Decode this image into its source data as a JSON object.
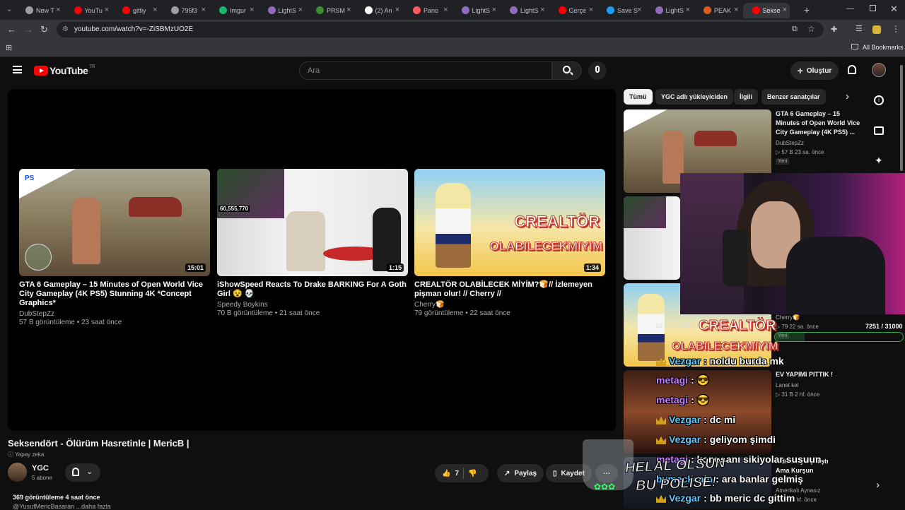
{
  "browser": {
    "tabs": [
      {
        "label": "New T",
        "color": "#9aa0a6"
      },
      {
        "label": "YouTu",
        "color": "#ff0000"
      },
      {
        "label": "gittiy",
        "color": "#ff0000"
      },
      {
        "label": "795f3",
        "color": "#9aa0a6"
      },
      {
        "label": "Imgur",
        "color": "#1bb76e"
      },
      {
        "label": "LightS",
        "color": "#8e6bbf"
      },
      {
        "label": "PRSM",
        "color": "#3c8d2f"
      },
      {
        "label": "(2) An",
        "color": "#ffffff"
      },
      {
        "label": "Pano",
        "color": "#ff5a5f"
      },
      {
        "label": "LightS",
        "color": "#8e6bbf"
      },
      {
        "label": "LightS",
        "color": "#8e6bbf"
      },
      {
        "label": "Gerçe",
        "color": "#ff0000"
      },
      {
        "label": "Save S",
        "color": "#1d9bf0"
      },
      {
        "label": "LightS",
        "color": "#8e6bbf"
      },
      {
        "label": "PEAK",
        "color": "#e05a1c"
      },
      {
        "label": "Sekse",
        "color": "#ff0000",
        "active": true
      }
    ],
    "url": "youtube.com/watch?v=-ZiSBMzUO2E",
    "bookmarks_label": "All Bookmarks"
  },
  "youtube": {
    "logo": "YouTube",
    "region": "TR",
    "search_placeholder": "Ara",
    "create_label": "Oluştur"
  },
  "player": {
    "endcards": [
      {
        "title": "GTA 6 Gameplay – 15 Minutes of Open World Vice City Gameplay (4K PS5) Stunning 4K *Concept Graphics*",
        "channel": "DubStepZz",
        "meta": "57 B görüntüleme • 23 saat önce",
        "duration": "15:01"
      },
      {
        "title": "iShowSpeed Reacts To Drake BARKING For A Goth Girl 😵 💀",
        "channel": "Speedy Boykins",
        "meta": "70 B görüntüleme • 21 saat önce",
        "duration": "1:15",
        "overlay_count": "60,555,770"
      },
      {
        "title": "CREALTÖR OLABİLECEK MİYİM?🍞// İzlemeyen pişman olur! // Cherry //",
        "channel": "Cherry🍞",
        "meta": "79 görüntüleme • 22 saat önce",
        "duration": "1:34",
        "thumb_text_1": "CREALTÖR",
        "thumb_text_2": "OLABILECEKMIYIM"
      }
    ]
  },
  "video": {
    "title": "Seksendört - Ölürüm Hasretinle | MericB |",
    "ai_badge": "Yapay zeka",
    "channel_name": "YGC",
    "subscribers": "5 abone",
    "likes": "7",
    "share_label": "Paylaş",
    "save_label": "Kaydet",
    "stats": "369 görüntüleme  4 saat önce",
    "description_preview": "@YusufMericBasaran ...daha fazla"
  },
  "sidebar": {
    "chips": [
      "Tümü",
      "YGC adlı yükleyiciden",
      "İlgili",
      "Benzer sanatçılar"
    ],
    "items": [
      {
        "title": "GTA 6 Gameplay – 15 Minutes of Open World Vice City Gameplay (4K PS5) ...",
        "channel": "DubStepZz",
        "meta": "▷ 57 B  23 sa. önce",
        "badge": "Yeni"
      },
      {
        "title": "",
        "channel": "",
        "meta": "",
        "badge": ""
      },
      {
        "title": "",
        "channel": "Cherry🍞",
        "meta": "▷ 79  22 sa. önce",
        "badge": "Yeni"
      },
      {
        "title": "EV YAPIMI PITTIK !",
        "channel": "Lanet kel",
        "meta": "▷ 31 B  2 hf. önce"
      },
      {
        "title": "...dürmeye Çalıştı Ama Kurşun",
        "channel": "Amerikalı Aynasız",
        "meta": "1.43 r  2 hf. önce"
      }
    ]
  },
  "overlay": {
    "progress_text": "7251 / 31000",
    "progress_fraction": 0.234,
    "thumb_overlay_1": "CREALTÖR",
    "thumb_overlay_2": "OLABILECEKMIYIM",
    "monitor_label": "EL MONİTÖR",
    "alert_text_1": "HELAL OLSUN",
    "alert_text_2": "BU POLİSE!",
    "chat": [
      {
        "user": "Vezgar",
        "msg": ": noldu burda mk",
        "color": "#5bc8ff",
        "crown": true
      },
      {
        "user": "metagi",
        "msg": ": 😎",
        "color": "#c77dff",
        "crown": false
      },
      {
        "user": "metagi",
        "msg": ": 😎",
        "color": "#c77dff",
        "crown": false
      },
      {
        "user": "Vezgar",
        "msg": ": dc mi",
        "color": "#5bc8ff",
        "crown": true
      },
      {
        "user": "Vezgar",
        "msg": ": geliyom şimdi",
        "color": "#5bc8ff",
        "crown": true
      },
      {
        "user": "metagi",
        "msg": ": konuşanı sikiyolar susuun",
        "color": "#c77dff",
        "crown": false
      },
      {
        "user": "bymeckcain",
        "msg": ": ara banlar gelmiş",
        "color": "#5bc8ff",
        "crown": false
      },
      {
        "user": "Vezgar",
        "msg": ": bb meric dc gittim",
        "color": "#5bc8ff",
        "crown": true
      }
    ]
  }
}
